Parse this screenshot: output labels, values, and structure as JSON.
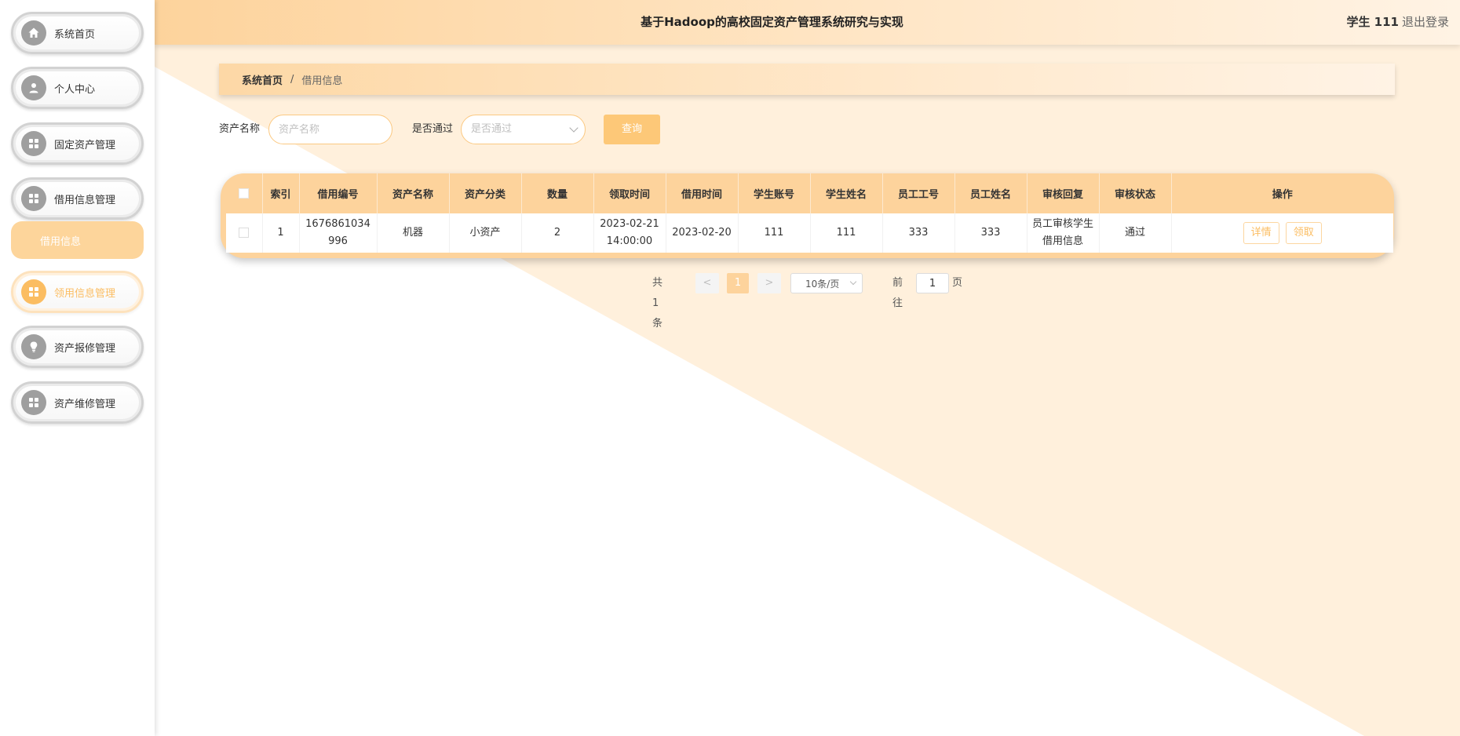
{
  "header": {
    "title": "基于Hadoop的高校固定资产管理系统研究与实现",
    "user": "学生 111",
    "logout": "退出登录"
  },
  "sidebar": {
    "items": [
      {
        "label": "系统首页",
        "icon": "home-icon"
      },
      {
        "label": "个人中心",
        "icon": "user-icon"
      },
      {
        "label": "固定资产管理",
        "icon": "grid-icon"
      },
      {
        "label": "借用信息管理",
        "icon": "grid-icon"
      },
      {
        "label": "领用信息管理",
        "icon": "grid-icon"
      },
      {
        "label": "资产报修管理",
        "icon": "lightbulb-icon"
      },
      {
        "label": "资产维修管理",
        "icon": "grid-icon"
      }
    ],
    "submenu": {
      "label": "借用信息"
    }
  },
  "breadcrumb": {
    "home": "系统首页",
    "separator": "/",
    "current": "借用信息"
  },
  "search": {
    "asset_name_label": "资产名称",
    "asset_name_placeholder": "资产名称",
    "approved_label": "是否通过",
    "approved_placeholder": "是否通过",
    "query_button": "查询"
  },
  "table": {
    "columns": [
      "",
      "索引",
      "借用编号",
      "资产名称",
      "资产分类",
      "数量",
      "领取时间",
      "借用时间",
      "学生账号",
      "学生姓名",
      "员工工号",
      "员工姓名",
      "审核回复",
      "审核状态",
      "操作"
    ],
    "rows": [
      {
        "index": "1",
        "borrow_no": "1676861034996",
        "asset_name": "机器",
        "category": "小资产",
        "quantity": "2",
        "receive_time": "2023-02-21 14:00:00",
        "borrow_time": "2023-02-20",
        "student_account": "111",
        "student_name": "111",
        "staff_no": "333",
        "staff_name": "333",
        "review_reply": "员工审核学生借用信息",
        "review_status": "通过",
        "actions": [
          "详情",
          "领取"
        ]
      }
    ]
  },
  "pagination": {
    "total": "共 1 条",
    "prev": "<",
    "current_page": "1",
    "next": ">",
    "page_size": "10条/页",
    "goto_label": "前往",
    "goto_value": "1",
    "page_suffix": "页"
  },
  "colors": {
    "accent": "#fdd39c",
    "accent_strong": "#fbbd62",
    "background_wedge": "#fff0dc"
  }
}
